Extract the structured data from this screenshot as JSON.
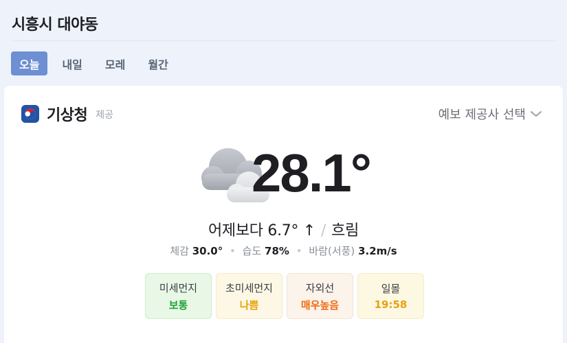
{
  "header": {
    "location": "시흥시 대야동",
    "tabs": [
      {
        "label": "오늘",
        "active": true
      },
      {
        "label": "내일",
        "active": false
      },
      {
        "label": "모레",
        "active": false
      },
      {
        "label": "월간",
        "active": false
      }
    ]
  },
  "provider": {
    "name": "기상청",
    "suffix": "제공",
    "select_label": "예보 제공사 선택",
    "logo_icon": "kma-logo-icon"
  },
  "current": {
    "weather_icon": "cloudy-icon",
    "temperature": "28.1°",
    "compare_text": "어제보다 6.7° ↑",
    "condition": "흐림",
    "feels_label": "체감",
    "feels_value": "30.0°",
    "humidity_label": "습도",
    "humidity_value": "78%",
    "wind_label": "바람(서풍)",
    "wind_value": "3.2m/s"
  },
  "badges": [
    {
      "label": "미세먼지",
      "value": "보통",
      "bg": "#e9f8e6",
      "border": "#cfeccb",
      "color": "#1fa336"
    },
    {
      "label": "초미세먼지",
      "value": "나쁨",
      "bg": "#fdf8e6",
      "border": "#f3ebc9",
      "color": "#e9a10c"
    },
    {
      "label": "자외선",
      "value": "매우높음",
      "bg": "#fcf3ea",
      "border": "#f1e4d6",
      "color": "#f06a10"
    },
    {
      "label": "일몰",
      "value": "19:58",
      "bg": "#fdf8e2",
      "border": "#f3ecc8",
      "color": "#e9a10c"
    }
  ]
}
